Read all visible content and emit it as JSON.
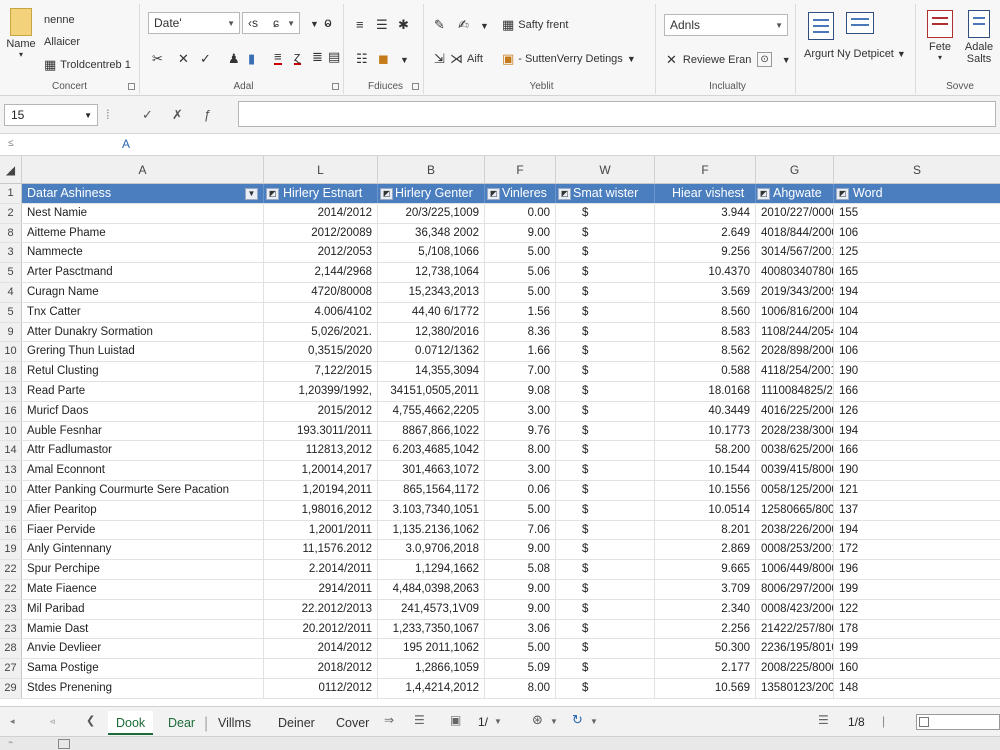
{
  "ribbon": {
    "clipboard": {
      "label": "Concert",
      "name_btn": "Name",
      "btn1": "nenne",
      "btn2": "Allaicer",
      "btn3": "Troldcentreb 1"
    },
    "font": {
      "label": "Adal",
      "font_name": "Date'",
      "font_size": "‹s"
    },
    "alignment": {
      "label": "Fdiuces"
    },
    "number": {
      "label": "Yeblit",
      "btn1": "Safty frent",
      "btn2": "Aift",
      "btn3": "SuttenVerry Detings"
    },
    "styles": {
      "label": "Inclualty",
      "dropdown": "Adnls",
      "btn1": "Reviewe Eran"
    },
    "editing": {
      "btn1": "Argurt Ny Detpicet"
    },
    "save": {
      "label": "Sovve",
      "btn1": "Fete",
      "btn2": "Adale",
      "btn3": "Salts"
    }
  },
  "formula_bar": {
    "name_box": "15",
    "formula": "",
    "col_indicator": "A"
  },
  "columns": [
    "A",
    "L",
    "B",
    "F",
    "W",
    "F",
    "G",
    "S"
  ],
  "header_row": {
    "num": "1",
    "cells": [
      "Datar Ashiness",
      "Hirlery Estnart",
      "Hirlery Genter",
      "Vinleres",
      "Smat wister",
      "Hiear vishest",
      "Ahgwate",
      "Word"
    ]
  },
  "rows": [
    {
      "num": "2",
      "c": [
        "Nest Namie",
        "2014/2012",
        "20/3/225,1009",
        "0.00",
        "$",
        "3.944",
        "2010/227/0000",
        "155"
      ]
    },
    {
      "num": "8",
      "c": [
        "Aitteme Phame",
        "2012/20089",
        "36,348 2002",
        "9.00",
        "$",
        "2.649",
        "4018/844/2000",
        "106"
      ]
    },
    {
      "num": "3",
      "c": [
        "Nammecte",
        "2012/2053",
        "5,/108,1066",
        "5.00",
        "$",
        "9.256",
        "3014/567/2001",
        "125"
      ]
    },
    {
      "num": "5",
      "c": [
        "Arter Pasctmand",
        "2,144/2968",
        "12,738,1064",
        "5.06",
        "$",
        "10.4370",
        "400803407800",
        "165"
      ]
    },
    {
      "num": "4",
      "c": [
        "Curagn Name",
        "4720/80008",
        "15,2343,2013",
        "5.00",
        "$",
        "3.569",
        "2019/343/2009",
        "194"
      ]
    },
    {
      "num": "5",
      "c": [
        "Tnx Catter",
        "4.006/4102",
        "44,40 6/1772",
        "1.56",
        "$",
        "8.560",
        "1006/816/2000",
        "104"
      ]
    },
    {
      "num": "9",
      "c": [
        "Atter Dunakry Sormation",
        "5,026/2021.",
        "12,380/2016",
        "8.36",
        "$",
        "8.583",
        "1108/244/2054",
        "104"
      ]
    },
    {
      "num": "10",
      "c": [
        "Grering Thun Luistad",
        "0,3515/2020",
        "0.0712/1362",
        "1.66",
        "$",
        "8.562",
        "2028/898/2000",
        "106"
      ]
    },
    {
      "num": "18",
      "c": [
        "Retul Clusting",
        "7,122/2015",
        "14,355,3094",
        "7.00",
        "$",
        "0.588",
        "4118/254/2001",
        "190"
      ]
    },
    {
      "num": "13",
      "c": [
        "Read Parte",
        "1,20399/1992,",
        "34151,0505,2011",
        "9.08",
        "$",
        "18.0168",
        "1110084825/2011",
        "166"
      ]
    },
    {
      "num": "16",
      "c": [
        "Muricf Daos",
        "2015/2012",
        "4,755,4662,2205",
        "3.00",
        "$",
        "40.3449",
        "4016/225/2000",
        "126"
      ]
    },
    {
      "num": "10",
      "c": [
        "Auble Fesnhar",
        "193.3011/2011",
        "8867,866,1022",
        "9.76",
        "$",
        "10.1773",
        "2028/238/3000",
        "194"
      ]
    },
    {
      "num": "14",
      "c": [
        "Attr Fadlumastor",
        "112813,2012",
        "6.203,4685,1042",
        "8.00",
        "$",
        "58.200",
        "0038/625/2000",
        "166"
      ]
    },
    {
      "num": "13",
      "c": [
        "Amal Econnont",
        "1,20014,2017",
        "301,4663,1072",
        "3.00",
        "$",
        "10.1544",
        "0039/415/8000",
        "190"
      ]
    },
    {
      "num": "10",
      "c": [
        "Atter Panking Courmurte Sere Pacation",
        "1,20194,2011",
        "865,1564,1172",
        "0.06",
        "$",
        "10.1556",
        "0058/125/2000",
        "121"
      ]
    },
    {
      "num": "19",
      "c": [
        "Afier Pearitop",
        "1,98016,2012",
        "3.103,7340,1051",
        "5.00",
        "$",
        "10.0514",
        "12580665/8000",
        "137"
      ]
    },
    {
      "num": "16",
      "c": [
        "Fiaer Pervide",
        "1,2001/2011",
        "1,135.2136,1062",
        "7.06",
        "$",
        "8.201",
        "2038/226/2000",
        "194"
      ]
    },
    {
      "num": "19",
      "c": [
        "Anly Gintennany",
        "11,1576.2012",
        "3.0,9706,2018",
        "9.00",
        "$",
        "2.869",
        "0008/253/2001",
        "172"
      ]
    },
    {
      "num": "22",
      "c": [
        "Spur Perchipe",
        "2.2014/2011",
        "1,1294,1662",
        "5.08",
        "$",
        "9.665",
        "1006/449/8000",
        "196"
      ]
    },
    {
      "num": "22",
      "c": [
        "Mate Fiaence",
        "2914/2011",
        "4,484,0398,2063",
        "9.00",
        "$",
        "3.709",
        "8006/297/2000",
        "199"
      ]
    },
    {
      "num": "23",
      "c": [
        "Mil Paribad",
        "22.2012/2013",
        "241,4573,1V09",
        "9.00",
        "$",
        "2.340",
        "0008/423/2006",
        "122"
      ]
    },
    {
      "num": "23",
      "c": [
        "Mamie Dast",
        "20.2012/2011",
        "1,233,7350,1067",
        "3.06",
        "$",
        "2.256",
        "21422/257/8002",
        "178"
      ]
    },
    {
      "num": "28",
      "c": [
        "Anvie Devlieer",
        "2014/2012",
        "195 2011,1062",
        "5.00",
        "$",
        "50.300",
        "2236/195/8010",
        "199"
      ]
    },
    {
      "num": "27",
      "c": [
        "Sama Postige",
        "2018/2012",
        "1,2866,1059",
        "5.09",
        "$",
        "2.177",
        "2008/225/8000",
        "160"
      ]
    },
    {
      "num": "29",
      "c": [
        "Stdes Prenening",
        "0112/2012",
        "1,4,4214,2012",
        "8.00",
        "$",
        "10.569",
        "13580123/2000",
        "148"
      ]
    }
  ],
  "sheet_tabs": [
    "Dook",
    "Dear",
    "Villms",
    "Deiner",
    "Cover"
  ],
  "active_tab": "Dook",
  "page_indicator": "1/",
  "page_indicator_right": "1/8",
  "colors": {
    "header_fill": "#4a7ebf",
    "active_tab": "#1e6b3a"
  }
}
